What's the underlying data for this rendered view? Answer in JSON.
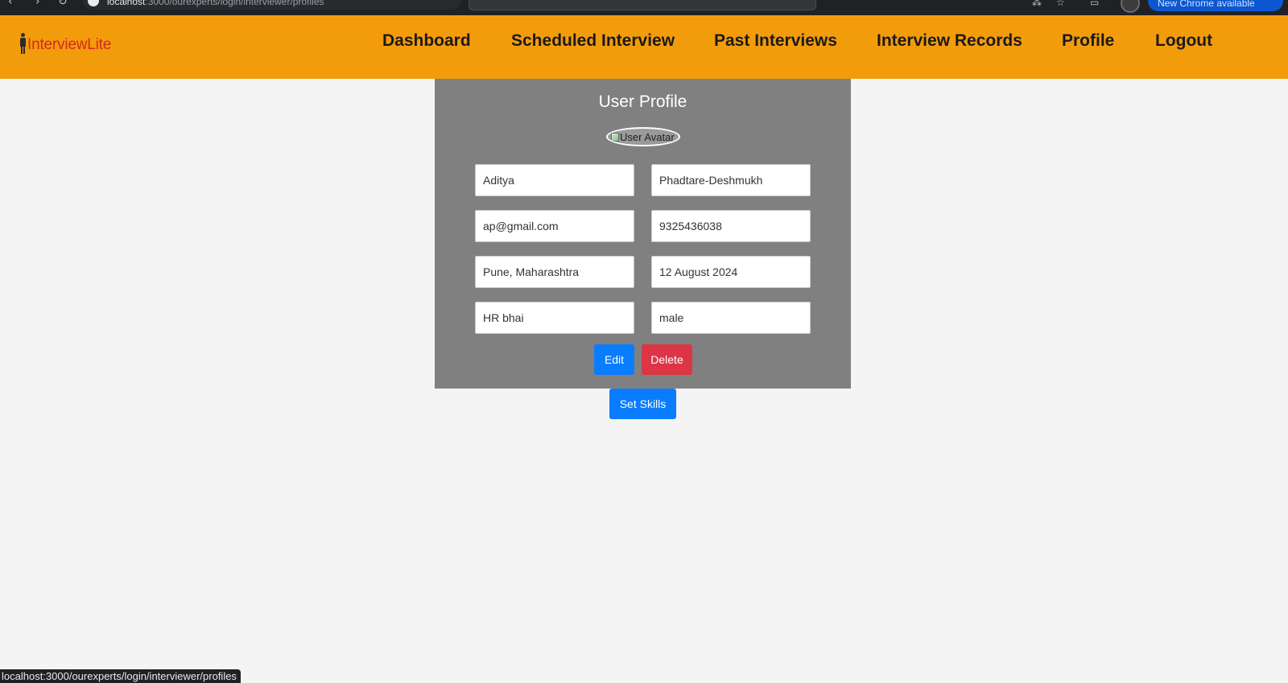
{
  "browser": {
    "url_host": "localhost",
    "url_rest": ":3000/ourexperts/login/interviewer/profiles",
    "update_label": "New Chrome available",
    "status_url": "localhost:3000/ourexperts/login/interviewer/profiles"
  },
  "header": {
    "logo_text": "InterviewLite",
    "nav": [
      {
        "label": "Dashboard"
      },
      {
        "label": "Scheduled Interview"
      },
      {
        "label": "Past Interviews"
      },
      {
        "label": "Interview Records"
      },
      {
        "label": "Profile"
      },
      {
        "label": "Logout"
      }
    ]
  },
  "profile": {
    "title": "User Profile",
    "avatar_alt": "User Avatar",
    "fields": {
      "first_name": "Aditya",
      "last_name": "Phadtare-Deshmukh",
      "email": "ap@gmail.com",
      "phone": "9325436038",
      "location": "Pune, Maharashtra",
      "date": "12 August 2024",
      "role": "HR bhai",
      "gender": "male"
    },
    "edit_label": "Edit",
    "delete_label": "Delete",
    "set_skills_label": "Set Skills"
  },
  "colors": {
    "header_bg": "#f39c0b",
    "card_bg": "#808080",
    "primary": "#0a7cff",
    "danger": "#dc3545",
    "logo_text": "#d42a1c"
  }
}
